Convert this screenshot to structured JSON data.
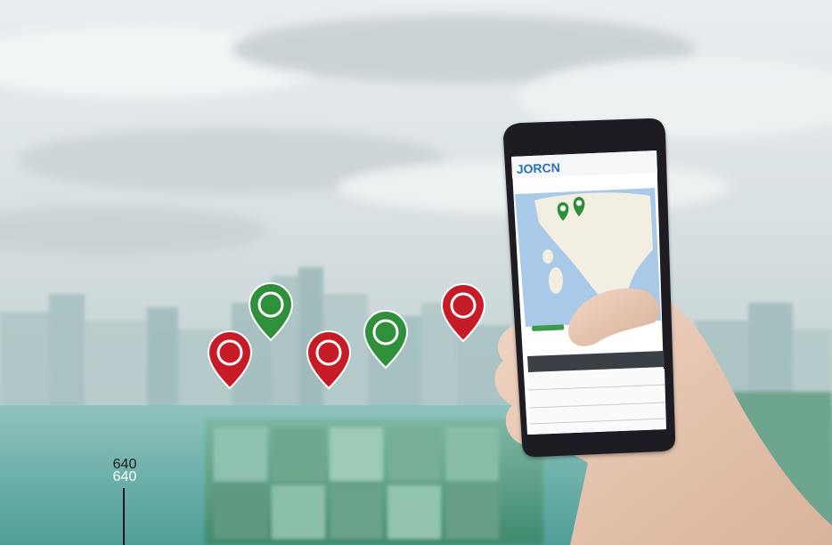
{
  "scene": {
    "description_label": "640",
    "overlay_label_top": "640",
    "overlay_label_bottom": "640",
    "phone_app_logo": "JORCN",
    "pins": [
      {
        "color": "#c51c28",
        "kind": "red-pin"
      },
      {
        "color": "#2f8f3a",
        "kind": "green-pin"
      },
      {
        "color": "#c51c28",
        "kind": "red-pin"
      },
      {
        "color": "#2f8f3a",
        "kind": "green-pin"
      },
      {
        "color": "#c51c28",
        "kind": "red-pin"
      }
    ],
    "colors": {
      "sky": "#dfe6e8",
      "water": "#6ab0aa",
      "phone_body": "#1d1f22",
      "screen_map_sea": "#a9c9e8",
      "screen_map_land": "#f2eee2",
      "skin": "#e8c7b0"
    }
  }
}
